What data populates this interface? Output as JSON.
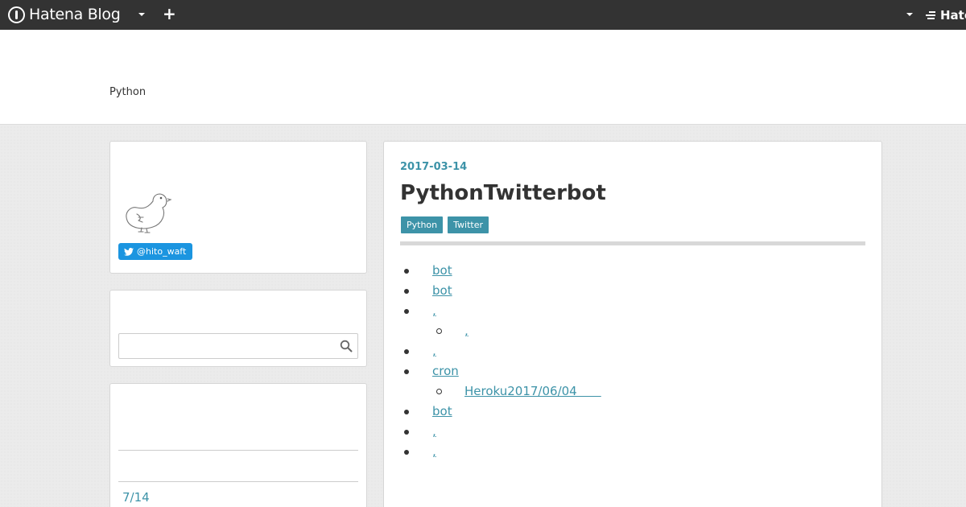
{
  "topbar": {
    "brand": "Hatena Blog",
    "plus": "+",
    "right_brand": "Hate"
  },
  "header": {
    "description": "Python"
  },
  "profile": {
    "twitter_handle": "@hito_waft"
  },
  "search": {
    "placeholder": "",
    "value": ""
  },
  "archive": {
    "link": "7/14"
  },
  "entry": {
    "date": "2017-03-14",
    "title": "PythonTwitterbot",
    "categories": [
      "Python",
      "Twitter"
    ],
    "toc": [
      {
        "text": "bot",
        "level": 1
      },
      {
        "text": "bot",
        "level": 1
      },
      {
        "text": ",",
        "level": 1
      },
      {
        "text": ",",
        "level": 2
      },
      {
        "text": ",",
        "level": 1
      },
      {
        "text": "cron",
        "level": 1
      },
      {
        "text": "Heroku2017/06/04　　",
        "level": 2
      },
      {
        "text": "bot",
        "level": 1
      },
      {
        "text": ",",
        "level": 1
      },
      {
        "text": ",",
        "level": 1
      }
    ]
  },
  "colors": {
    "accent": "#3d93a8",
    "topbar": "#333333",
    "twitter": "#1b95e0"
  }
}
